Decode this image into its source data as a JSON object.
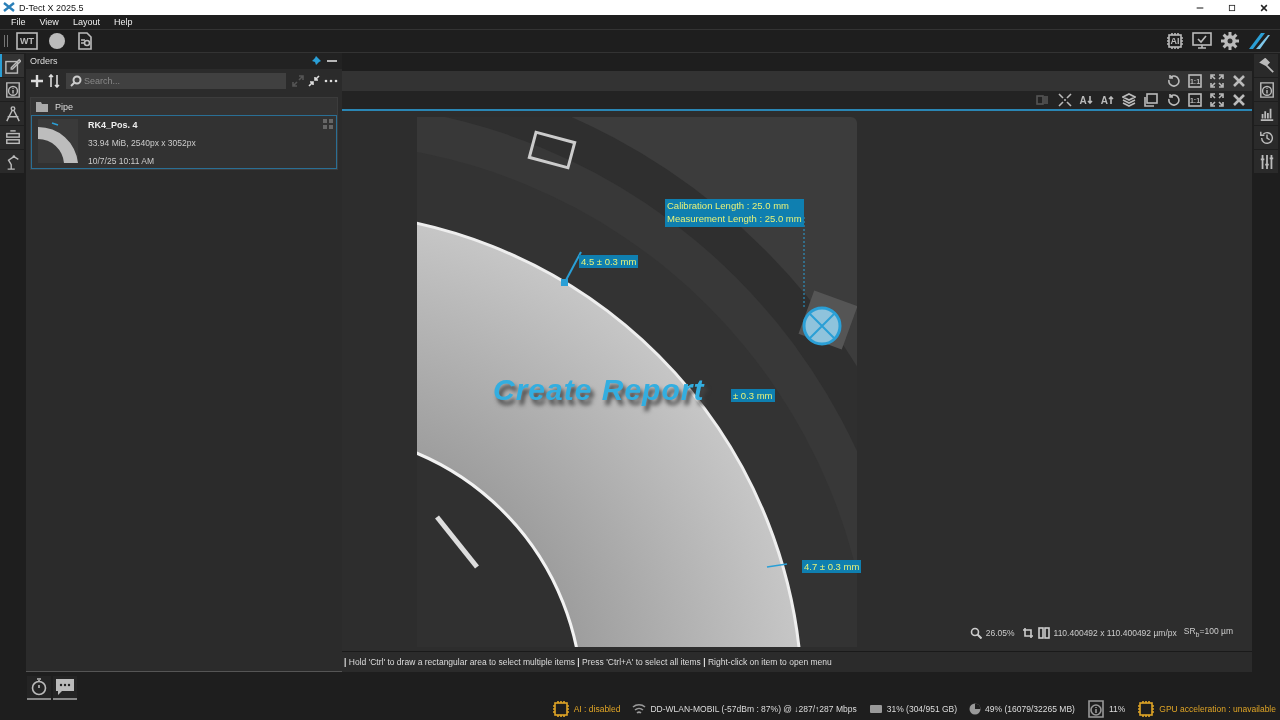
{
  "window": {
    "title": "D-Tect X 2025.5"
  },
  "menu": [
    "File",
    "View",
    "Layout",
    "Help"
  ],
  "toolbar": {
    "left": [
      {
        "kind": "wt",
        "label": "WT"
      },
      {
        "kind": "disc"
      },
      {
        "kind": "report"
      }
    ],
    "right": [
      {
        "kind": "chip",
        "label": "AI"
      },
      {
        "kind": "monitor-check"
      },
      {
        "kind": "gear"
      },
      {
        "kind": "brand"
      }
    ]
  },
  "left_rail": [
    {
      "kind": "edit",
      "selected": true
    },
    {
      "kind": "info",
      "selected": false
    },
    {
      "kind": "compass",
      "selected": false
    },
    {
      "kind": "stack",
      "selected": false
    },
    {
      "kind": "robot",
      "selected": false
    }
  ],
  "orders_panel": {
    "title": "Orders",
    "search": {
      "placeholder": "Search..."
    },
    "tree": [
      {
        "kind": "folder",
        "label": "Pipe",
        "children": [
          {
            "kind": "image",
            "title": "RK4_Pos. 4",
            "details": "33.94 MiB, 2540px x 3052px",
            "date": "10/7/25 10:11 AM",
            "selected": true
          }
        ]
      }
    ]
  },
  "viewer": {
    "toolbar_1": [
      {
        "kind": "rotate"
      },
      {
        "kind": "one-to-one",
        "label": "1:1"
      },
      {
        "kind": "fullscreen"
      },
      {
        "kind": "close"
      }
    ],
    "toolbar_2": [
      {
        "kind": "compare",
        "disabled": true
      },
      {
        "kind": "fit"
      },
      {
        "kind": "font-down",
        "label": "A"
      },
      {
        "kind": "font-up",
        "label": "A"
      },
      {
        "kind": "layers"
      },
      {
        "kind": "image"
      },
      {
        "kind": "rotate"
      },
      {
        "kind": "one-to-one",
        "label": "1:1"
      },
      {
        "kind": "fullscreen"
      },
      {
        "kind": "close"
      }
    ],
    "annotations": [
      {
        "kind": "calibration",
        "lines": [
          "Calibration Length : 25.0 mm",
          "Measurement Length : 25.0 mm"
        ]
      },
      {
        "kind": "measure",
        "text": "4.5 ± 0.3 mm"
      },
      {
        "kind": "measure",
        "text": "± 0.3 mm"
      },
      {
        "kind": "measure",
        "text": "4.7 ± 0.3 mm"
      }
    ],
    "caption": "Create Report",
    "info": {
      "zoom": "26.05%",
      "pixel_size": "110.400492 x 110.400492 µm/px",
      "resolution": "SR$_{b}$=100 µm"
    },
    "hint": "**|** Hold 'Ctrl' to draw a rectangular area to select multiple items **|** Press 'Ctrl+A' to select all items **|** Right-click on item to open menu"
  },
  "right_rail": [
    {
      "kind": "hammer"
    },
    {
      "kind": "info"
    },
    {
      "kind": "chart"
    },
    {
      "kind": "history"
    },
    {
      "kind": "sliders"
    }
  ],
  "bottom_tabs": [
    {
      "kind": "stopwatch"
    },
    {
      "kind": "chat"
    }
  ],
  "status_bar": [
    {
      "kind": "chip",
      "text": "AI : disabled",
      "warning": true
    },
    {
      "kind": "wifi",
      "text": "DD-WLAN-MOBIL (-57dBm : 87%) @ ↓287/↑287 Mbps",
      "warning": false
    },
    {
      "kind": "disk",
      "text": "31% (304/951 GB)",
      "warning": false
    },
    {
      "kind": "pie",
      "text": "49% (16079/32265 MB)",
      "warning": false
    },
    {
      "kind": "info",
      "text": "11%",
      "warning": false
    },
    {
      "kind": "chip",
      "text": "GPU acceleration : unavailable",
      "warning": true
    }
  ]
}
